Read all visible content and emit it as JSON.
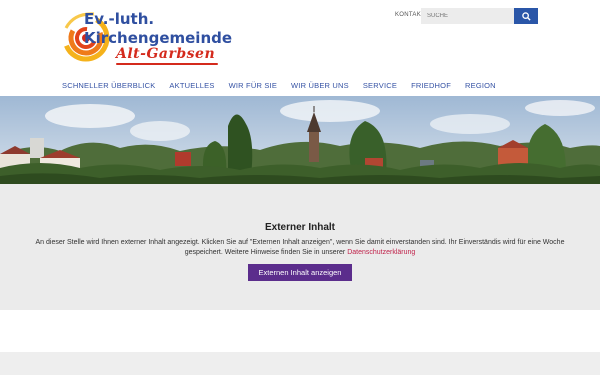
{
  "logo": {
    "line1": "Ev.-luth.",
    "line2": "Kirchengemeinde",
    "line3": "Alt-Garbsen"
  },
  "header": {
    "kontakt_label": "KONTAKT",
    "search_placeholder": "SUCHE",
    "search_icon": "search-icon"
  },
  "nav": {
    "items": [
      {
        "label": "SCHNELLER ÜBERBLICK"
      },
      {
        "label": "AKTUELLES"
      },
      {
        "label": "WIR FÜR SIE"
      },
      {
        "label": "WIR ÜBER UNS"
      },
      {
        "label": "SERVICE"
      },
      {
        "label": "FRIEDHOF"
      },
      {
        "label": "REGION"
      }
    ]
  },
  "external": {
    "title": "Externer Inhalt",
    "text": "An dieser Stelle wird Ihnen externer Inhalt angezeigt. Klicken Sie auf \"Externen Inhalt anzeigen\", wenn Sie damit einverstanden sind. Ihr Einverständis wird für eine Woche gespeichert. Weitere Hinweise finden Sie in unserer ",
    "link_label": "Datenschutzerklärung",
    "button_label": "Externen Inhalt anzeigen"
  },
  "colors": {
    "nav_text": "#3552a4",
    "search_button": "#2a56a8",
    "primary_button": "#5b2d8c",
    "link": "#c0234b",
    "logo_blue": "#2f4fa0",
    "logo_red": "#d42a1c"
  }
}
